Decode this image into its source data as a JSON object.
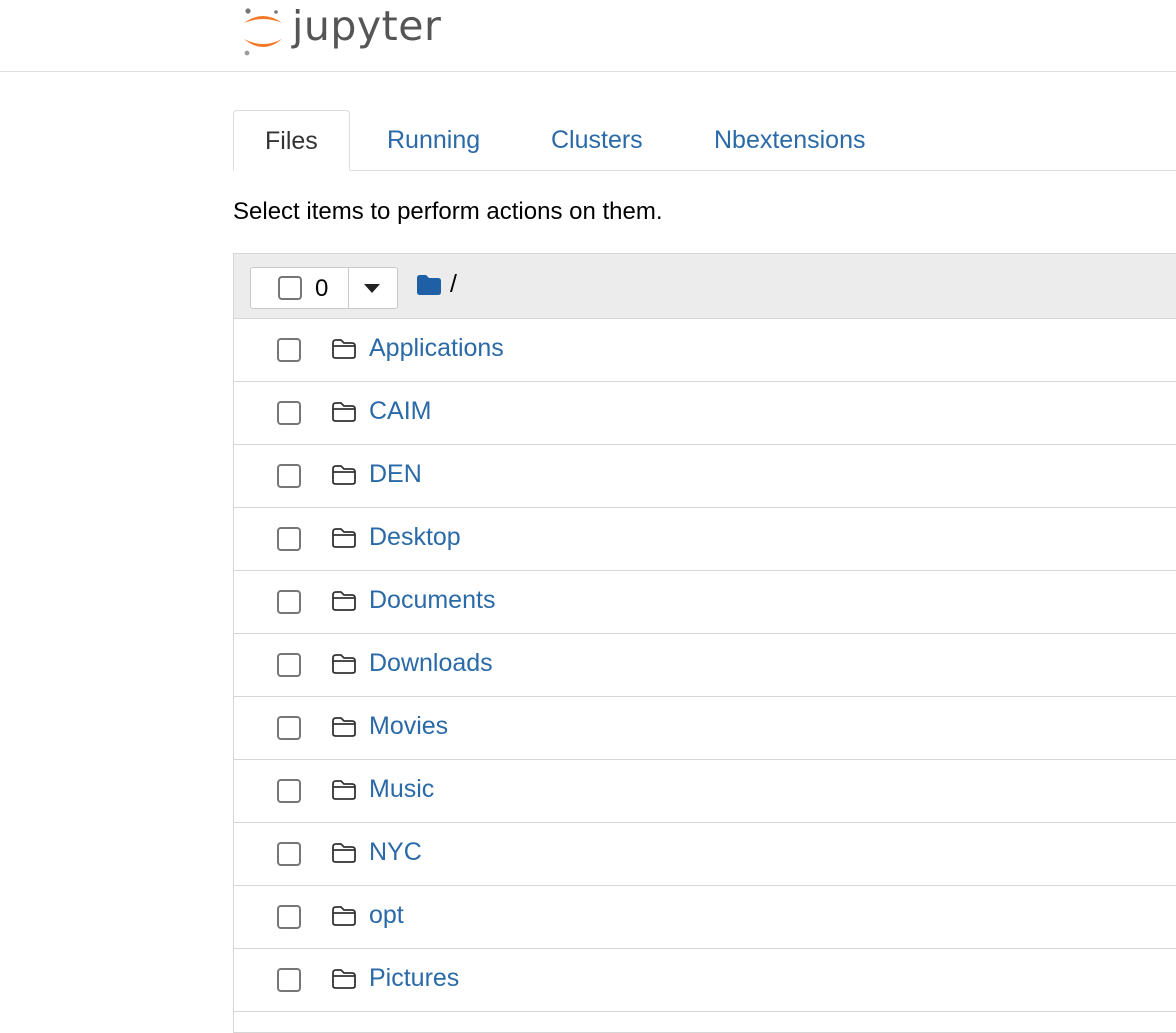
{
  "header": {
    "logo_text": "jupyter",
    "logo_icon": "jupyter-logo-icon",
    "brand_color": "#F37726"
  },
  "tabs": [
    {
      "label": "Files",
      "active": true
    },
    {
      "label": "Running",
      "active": false
    },
    {
      "label": "Clusters",
      "active": false
    },
    {
      "label": "Nbextensions",
      "active": false
    }
  ],
  "instructions": "Select items to perform actions on them.",
  "list_header": {
    "selected_count": "0",
    "dropdown_icon": "caret-down-icon",
    "breadcrumb_icon": "folder-solid-icon",
    "breadcrumb_path": "/"
  },
  "items": [
    {
      "name": "Applications",
      "icon": "folder-outline-icon"
    },
    {
      "name": "CAIM",
      "icon": "folder-outline-icon"
    },
    {
      "name": "DEN",
      "icon": "folder-outline-icon"
    },
    {
      "name": "Desktop",
      "icon": "folder-outline-icon"
    },
    {
      "name": "Documents",
      "icon": "folder-outline-icon"
    },
    {
      "name": "Downloads",
      "icon": "folder-outline-icon"
    },
    {
      "name": "Movies",
      "icon": "folder-outline-icon"
    },
    {
      "name": "Music",
      "icon": "folder-outline-icon"
    },
    {
      "name": "NYC",
      "icon": "folder-outline-icon"
    },
    {
      "name": "opt",
      "icon": "folder-outline-icon"
    },
    {
      "name": "Pictures",
      "icon": "folder-outline-icon"
    }
  ],
  "colors": {
    "link": "#2a6aa8",
    "header_bg": "#ececec"
  }
}
